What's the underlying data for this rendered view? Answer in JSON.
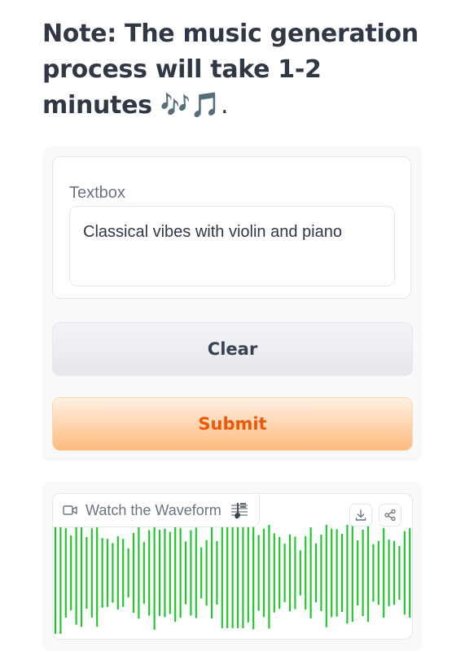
{
  "note": {
    "text": "Note: The music generation process will take 1-2 minutes",
    "emoji": "🎶🎵."
  },
  "input_panel": {
    "textbox": {
      "label": "Textbox",
      "value": "Classical vibes with violin and piano",
      "placeholder": ""
    },
    "clear_button": {
      "label": "Clear"
    },
    "submit_button": {
      "label": "Submit"
    }
  },
  "output_panel": {
    "video": {
      "label": "Watch the Waveform",
      "label_icon": "video-icon",
      "label_emoji_icon": "treble-clef-icon",
      "actions": [
        {
          "name": "download",
          "icon": "download-icon"
        },
        {
          "name": "share",
          "icon": "share-icon"
        }
      ],
      "waveform_color": "#22c62e"
    }
  },
  "colors": {
    "submit_text": "#ea580c",
    "submit_bg_top": "#fff1e4",
    "submit_bg_bottom": "#fdba7d",
    "clear_bg": "#e5e7eb",
    "waveform": "#22c62e"
  }
}
